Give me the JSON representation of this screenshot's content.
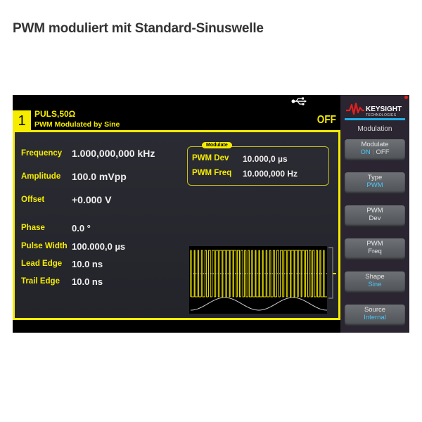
{
  "page_title": "PWM moduliert mit Standard-Sinuswelle",
  "status_bar": {
    "usb_icon": "usb-icon"
  },
  "channel": {
    "number": "1",
    "waveform": "PULS,50Ω",
    "modulation": "PWM Modulated by Sine",
    "output_state": "OFF"
  },
  "parameters": [
    {
      "label": "Frequency",
      "value": "1.000,000,000 kHz"
    },
    {
      "label": "Amplitude",
      "value": "100.0 mVpp"
    },
    {
      "label": "Offset",
      "value": "+0.000 V"
    },
    {
      "label": "Phase",
      "value": "0.0 °"
    },
    {
      "label": "Pulse Width",
      "value": "100.000,0 µs"
    },
    {
      "label": "Lead Edge",
      "value": "10.0 ns"
    },
    {
      "label": "Trail Edge",
      "value": "10.0 ns"
    }
  ],
  "modulate_box": {
    "tag": "Modulate",
    "rows": [
      {
        "label": "PWM Dev",
        "value": "10.000,0 µs"
      },
      {
        "label": "PWM Freq",
        "value": "10.000,000 Hz"
      }
    ]
  },
  "sidebar": {
    "brand": "KEYSIGHT",
    "brand_sub": "TECHNOLOGIES",
    "title": "Modulation",
    "softkeys": [
      {
        "label": "Modulate",
        "on": "ON",
        "sep": "|",
        "off": "OFF"
      },
      {
        "label": "Type",
        "value": "PWM"
      },
      {
        "label": "PWM",
        "value": "Dev"
      },
      {
        "label": "PWM",
        "value": "Freq"
      },
      {
        "label": "Shape",
        "value": "Sine"
      },
      {
        "label": "Source",
        "value": "Internal"
      }
    ]
  },
  "colors": {
    "accent_yellow": "#f5ec00",
    "value_blue": "#4bc4f4",
    "keysight_red": "#e02020"
  }
}
